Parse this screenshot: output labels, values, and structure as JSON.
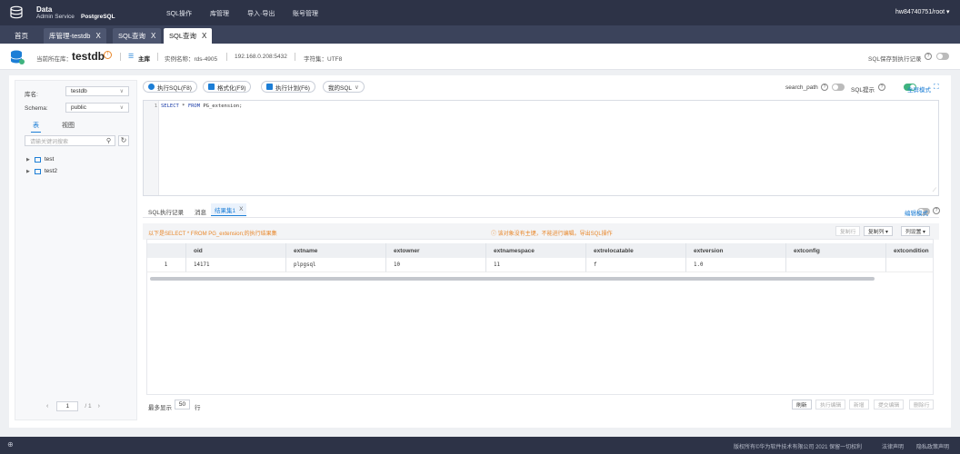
{
  "brand": {
    "line1": "Data",
    "line2": "Admin Service",
    "line3": "PostgreSQL"
  },
  "top_menu": [
    "SQL操作",
    "库管理",
    "导入·导出",
    "账号管理"
  ],
  "user": "hw84740751/root ▾",
  "tabs": [
    {
      "label": "首页"
    },
    {
      "label": "库管理-testdb",
      "close": "X"
    },
    {
      "label": "SQL查询",
      "close": "X"
    },
    {
      "label": "SQL查询",
      "close": "X"
    }
  ],
  "info": {
    "current_db_label": "当前所在库：",
    "db_name": "testdb",
    "role": "主库",
    "instance": "实例名称：rds-4905",
    "address": "192.168.0.208:5432",
    "charset": "字符集：UTF8",
    "save_sql": "SQL保存到执行记录"
  },
  "left": {
    "db_label": "库名:",
    "db_value": "testdb",
    "schema_label": "Schema:",
    "schema_value": "public",
    "tab_table": "表",
    "tab_view": "视图",
    "search_placeholder": "请输关键词搜索",
    "tree": [
      "test",
      "test2"
    ],
    "page_current": "1",
    "page_total": "/ 1"
  },
  "toolbar": {
    "run": "执行SQL(F8)",
    "format": "格式化(F9)",
    "plan": "执行计划(F6)",
    "my_sql": "我的SQL",
    "search_path": "search_path",
    "sql_hint": "SQL提示",
    "fullscreen": "全屏模式"
  },
  "editor": {
    "line": "1",
    "kw1": "SELECT",
    "mid": " * ",
    "kw2": "FROM",
    "rest": " PG_extension;"
  },
  "results": {
    "tab_history": "SQL执行记录",
    "tab_message": "消息",
    "tab_result": "结果集1",
    "tab_close": "X",
    "edit_mode": "编辑模式",
    "summary": "以下是SELECT * FROM PG_extension;的执行结果集",
    "warning": "ⓘ 该对象没有主键，不能进行编辑。导出SQL操作",
    "copy_row": "复制行",
    "copy_col": "复制列 ▾",
    "col_settings": "列设置 ▾",
    "columns": [
      "",
      "oid",
      "extname",
      "extowner",
      "extnamespace",
      "extrelocatable",
      "extversion",
      "extconfig",
      "extcondition"
    ],
    "rows": [
      [
        "1",
        "14171",
        "plpgsql",
        "10",
        "11",
        "f",
        "1.0",
        "",
        ""
      ]
    ],
    "max_label": "最多显示",
    "max_value": "50",
    "max_unit": "行",
    "btn_refresh": "刷新",
    "btn_exec_edit": "执行编辑",
    "btn_new": "新增",
    "btn_submit": "提交编辑",
    "btn_delete": "删除行"
  },
  "footer": {
    "copyright": "版权所有©华为软件技术有限公司 2021 保留一切权利",
    "legal": "法律声明",
    "privacy": "隐私政策声明"
  },
  "colors": {
    "topbar": "#2d3347",
    "accent": "#1c7ed6",
    "green": "#3fb37f",
    "warning": "#e8872b"
  }
}
